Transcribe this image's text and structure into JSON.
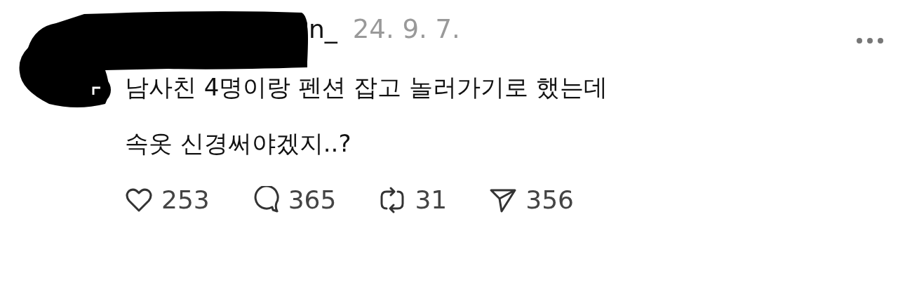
{
  "post": {
    "username": "n_",
    "date": "24. 9. 7.",
    "text": "남사친 4명이랑 펜션 잡고 놀러가기로 했는데\n속옷 신경써야겠지..?",
    "actions": [
      {
        "kind": "like",
        "count": "253"
      },
      {
        "kind": "comment",
        "count": "365"
      },
      {
        "kind": "repost",
        "count": "31"
      },
      {
        "kind": "share",
        "count": "356"
      }
    ]
  }
}
